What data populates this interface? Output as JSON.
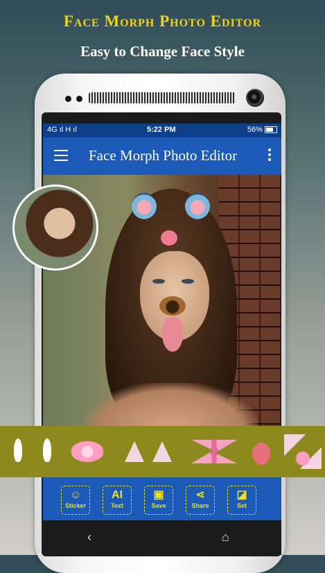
{
  "headline": {
    "title": "Face Morph Photo Editor",
    "subtitle": "Easy to Change Face Style"
  },
  "status_bar": {
    "left": "4G ıl H ıl",
    "time": "5:22 PM",
    "right": "56%"
  },
  "app_bar": {
    "title": "Face Morph Photo Editor"
  },
  "stickers": [
    "white-ears",
    "cat-nose",
    "pink-ears",
    "bow",
    "tongue",
    "pink-cat"
  ],
  "toolbar": {
    "items": [
      {
        "label": "Sticker",
        "glyph": "☺",
        "icon": "sticker-icon"
      },
      {
        "label": "Text",
        "glyph": "AI",
        "icon": "text-icon"
      },
      {
        "label": "Save",
        "glyph": "▣",
        "icon": "save-icon"
      },
      {
        "label": "Share",
        "glyph": "⋖",
        "icon": "share-icon"
      },
      {
        "label": "Set",
        "glyph": "◪",
        "icon": "set-icon"
      }
    ]
  },
  "nav": {
    "back": "‹",
    "home": "⌂"
  },
  "colors": {
    "app_bar": "#1b5ab7",
    "status_bar": "#0e3f8a",
    "accent_yellow": "#f1e01a",
    "sticker_strip": "#8c8a1c"
  }
}
